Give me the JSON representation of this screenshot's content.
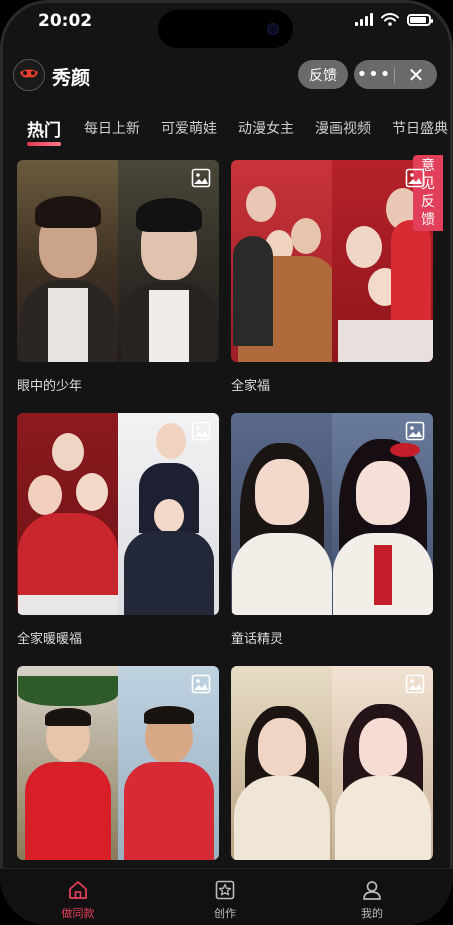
{
  "status": {
    "time": "20:02"
  },
  "app": {
    "title": "秀颜",
    "feedback_label": "反馈",
    "more_label": "•••",
    "close_label": "✕"
  },
  "tabs": [
    {
      "label": "热门"
    },
    {
      "label": "每日上新"
    },
    {
      "label": "可爱萌娃"
    },
    {
      "label": "动漫女主"
    },
    {
      "label": "漫画视频"
    },
    {
      "label": "节日盛典"
    }
  ],
  "cards": [
    {
      "title": "眼中的少年",
      "icon": "image-icon"
    },
    {
      "title": "全家福",
      "icon": "image-icon"
    },
    {
      "title": "全家暖暖福",
      "icon": "image-icon"
    },
    {
      "title": "童话精灵",
      "icon": "image-icon"
    },
    {
      "title": "",
      "icon": "image-icon"
    },
    {
      "title": "",
      "icon": "image-icon"
    }
  ],
  "side_feedback": {
    "line1": "意",
    "line2": "见",
    "line3": "反",
    "line4": "馈"
  },
  "bottom_nav": [
    {
      "label": "做同款",
      "icon": "home-icon",
      "active": true
    },
    {
      "label": "创作",
      "icon": "star-frame-icon",
      "active": false
    },
    {
      "label": "我的",
      "icon": "user-icon",
      "active": false
    }
  ],
  "colors": {
    "accent": "#e3405a",
    "background": "#141414"
  }
}
